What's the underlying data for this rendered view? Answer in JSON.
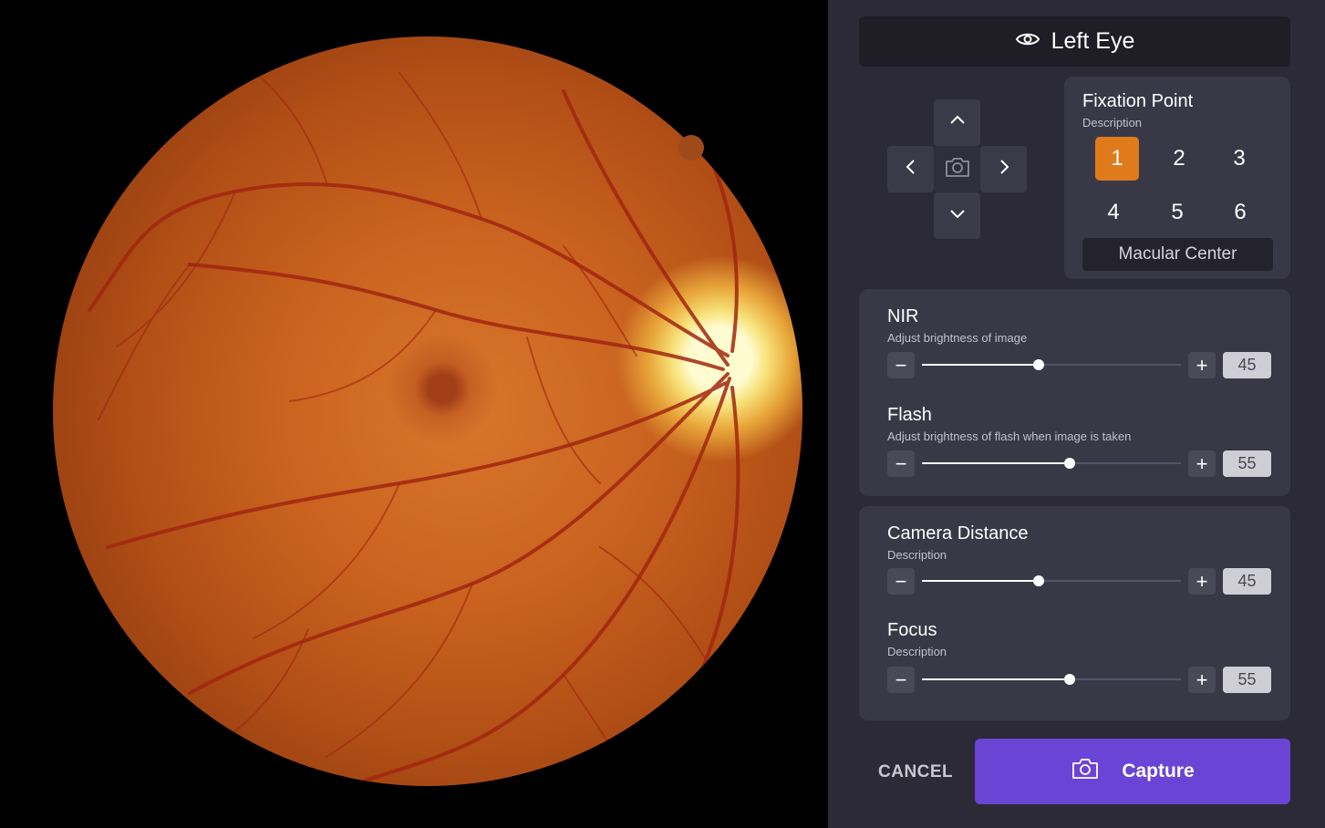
{
  "header": {
    "title": "Left Eye",
    "icon": "eye-icon"
  },
  "dpad": {
    "up_icon": "chevron-up-icon",
    "down_icon": "chevron-down-icon",
    "left_icon": "chevron-left-icon",
    "right_icon": "chevron-right-icon",
    "center_icon": "camera-icon"
  },
  "fixation": {
    "title": "Fixation Point",
    "description": "Description",
    "points": [
      "1",
      "2",
      "3",
      "4",
      "5",
      "6"
    ],
    "selected": "1",
    "selected_label": "Macular Center"
  },
  "controls": {
    "nir": {
      "title": "NIR",
      "description": "Adjust brightness of image",
      "value": "45",
      "level": 0.45
    },
    "flash": {
      "title": "Flash",
      "description": "Adjust brightness of flash when image is taken",
      "value": "55",
      "level": 0.57
    },
    "distance": {
      "title": "Camera Distance",
      "description": "Description",
      "value": "45",
      "level": 0.45
    },
    "focus": {
      "title": "Focus",
      "description": "Description",
      "value": "55",
      "level": 0.57
    }
  },
  "actions": {
    "cancel": "CANCEL",
    "capture": "Capture"
  },
  "colors": {
    "panel": "#2b2a36",
    "card": "#393846",
    "accent": "#6a44d4",
    "selected": "#e07b1c"
  }
}
